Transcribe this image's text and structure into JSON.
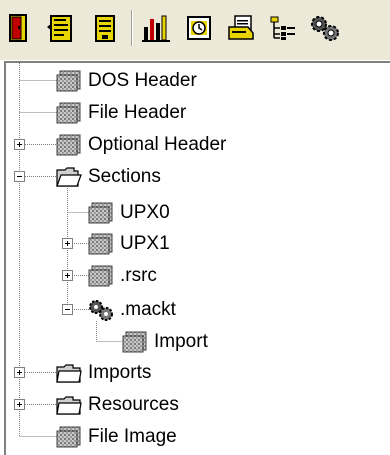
{
  "toolbar": {
    "buttons": [
      {
        "icon": "exit-door-icon"
      },
      {
        "icon": "open-file-icon"
      },
      {
        "icon": "save-file-icon"
      },
      {
        "icon": "bar-chart-icon"
      },
      {
        "icon": "clock-document-icon"
      },
      {
        "icon": "printer-document-icon"
      },
      {
        "icon": "tree-list-icon"
      },
      {
        "icon": "gears-icon"
      }
    ]
  },
  "tree": {
    "nodes": [
      {
        "label": "DOS Header",
        "icon": "grid-page-icon",
        "expander": "none"
      },
      {
        "label": "File Header",
        "icon": "grid-page-icon",
        "expander": "none"
      },
      {
        "label": "Optional Header",
        "icon": "grid-page-icon",
        "expander": "plus"
      },
      {
        "label": "Sections",
        "icon": "folder-open-icon",
        "expander": "minus"
      },
      {
        "label": "UPX0",
        "icon": "grid-page-icon",
        "expander": "none"
      },
      {
        "label": "UPX1",
        "icon": "grid-page-icon",
        "expander": "plus"
      },
      {
        "label": ".rsrc",
        "icon": "grid-page-icon",
        "expander": "plus"
      },
      {
        "label": ".mackt",
        "icon": "gears-icon",
        "expander": "minus"
      },
      {
        "label": "Import",
        "icon": "grid-page-icon",
        "expander": "none"
      },
      {
        "label": "Imports",
        "icon": "folder-icon",
        "expander": "plus"
      },
      {
        "label": "Resources",
        "icon": "folder-icon",
        "expander": "plus"
      },
      {
        "label": "File Image",
        "icon": "grid-page-icon",
        "expander": "none"
      }
    ]
  },
  "colors": {
    "toolbar_bg": "#ece9d8",
    "icon_yellow": "#e8d400",
    "icon_red": "#c00000",
    "tree_line": "#808080"
  }
}
